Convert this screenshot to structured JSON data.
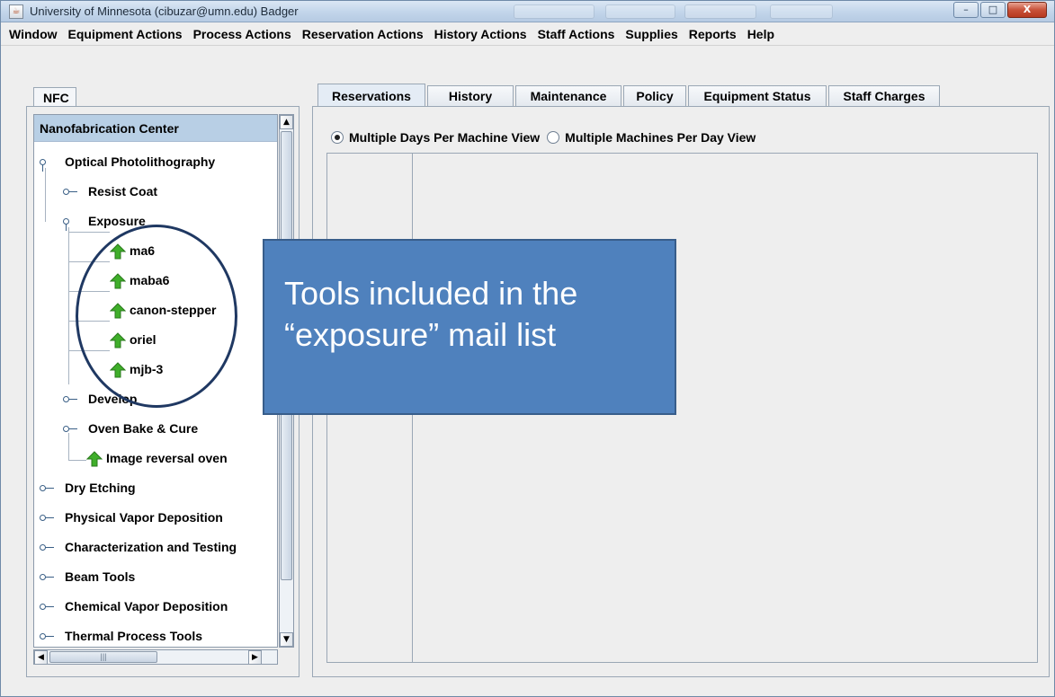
{
  "window": {
    "title": "University of Minnesota (cibuzar@umn.edu) Badger",
    "controls": {
      "minimize": "–",
      "maximize": "□",
      "close": "X"
    }
  },
  "menu": [
    "Window",
    "Equipment Actions",
    "Process Actions",
    "Reservation Actions",
    "History Actions",
    "Staff Actions",
    "Supplies",
    "Reports",
    "Help"
  ],
  "left_panel": {
    "tab": "NFC",
    "tree_header": "Nanofabrication Center",
    "nodes": {
      "optical": "Optical Photolithography",
      "resist": "Resist Coat",
      "exposure": "Exposure",
      "ma6": "ma6",
      "maba6": "maba6",
      "canon": "canon-stepper",
      "oriel": "oriel",
      "mjb3": "mjb-3",
      "develop": "Develop",
      "oven": "Oven Bake & Cure",
      "image_reversal": "Image reversal oven",
      "dry_etching": "Dry Etching",
      "pvd": "Physical Vapor Deposition",
      "characterization": "Characterization and Testing",
      "beam": "Beam Tools",
      "cvd": "Chemical Vapor Deposition",
      "thermal": "Thermal Process Tools"
    },
    "scroll": {
      "up": "▲",
      "down": "▼",
      "left": "◀",
      "right": "▶",
      "grip": "|||"
    }
  },
  "right_panel": {
    "tabs": [
      "Reservations",
      "History",
      "Maintenance",
      "Policy",
      "Equipment Status",
      "Staff Charges"
    ],
    "active_tab": "Reservations",
    "views": {
      "option1": "Multiple Days Per Machine View",
      "option2": "Multiple Machines Per Day View",
      "selected": "Multiple Days Per Machine View"
    }
  },
  "annotation": {
    "callout_text": "Tools included in the\n“exposure” mail list"
  },
  "icons": {
    "app": "java-icon",
    "tool_status": "green-up-arrow-icon",
    "tree_handle": "tree-handle-icon"
  },
  "colors": {
    "tree_header_bg": "#b8cfe5",
    "callout_bg": "#4f81bd",
    "ellipse_stroke": "#1f3862",
    "status_arrow": "#3fae2a"
  }
}
